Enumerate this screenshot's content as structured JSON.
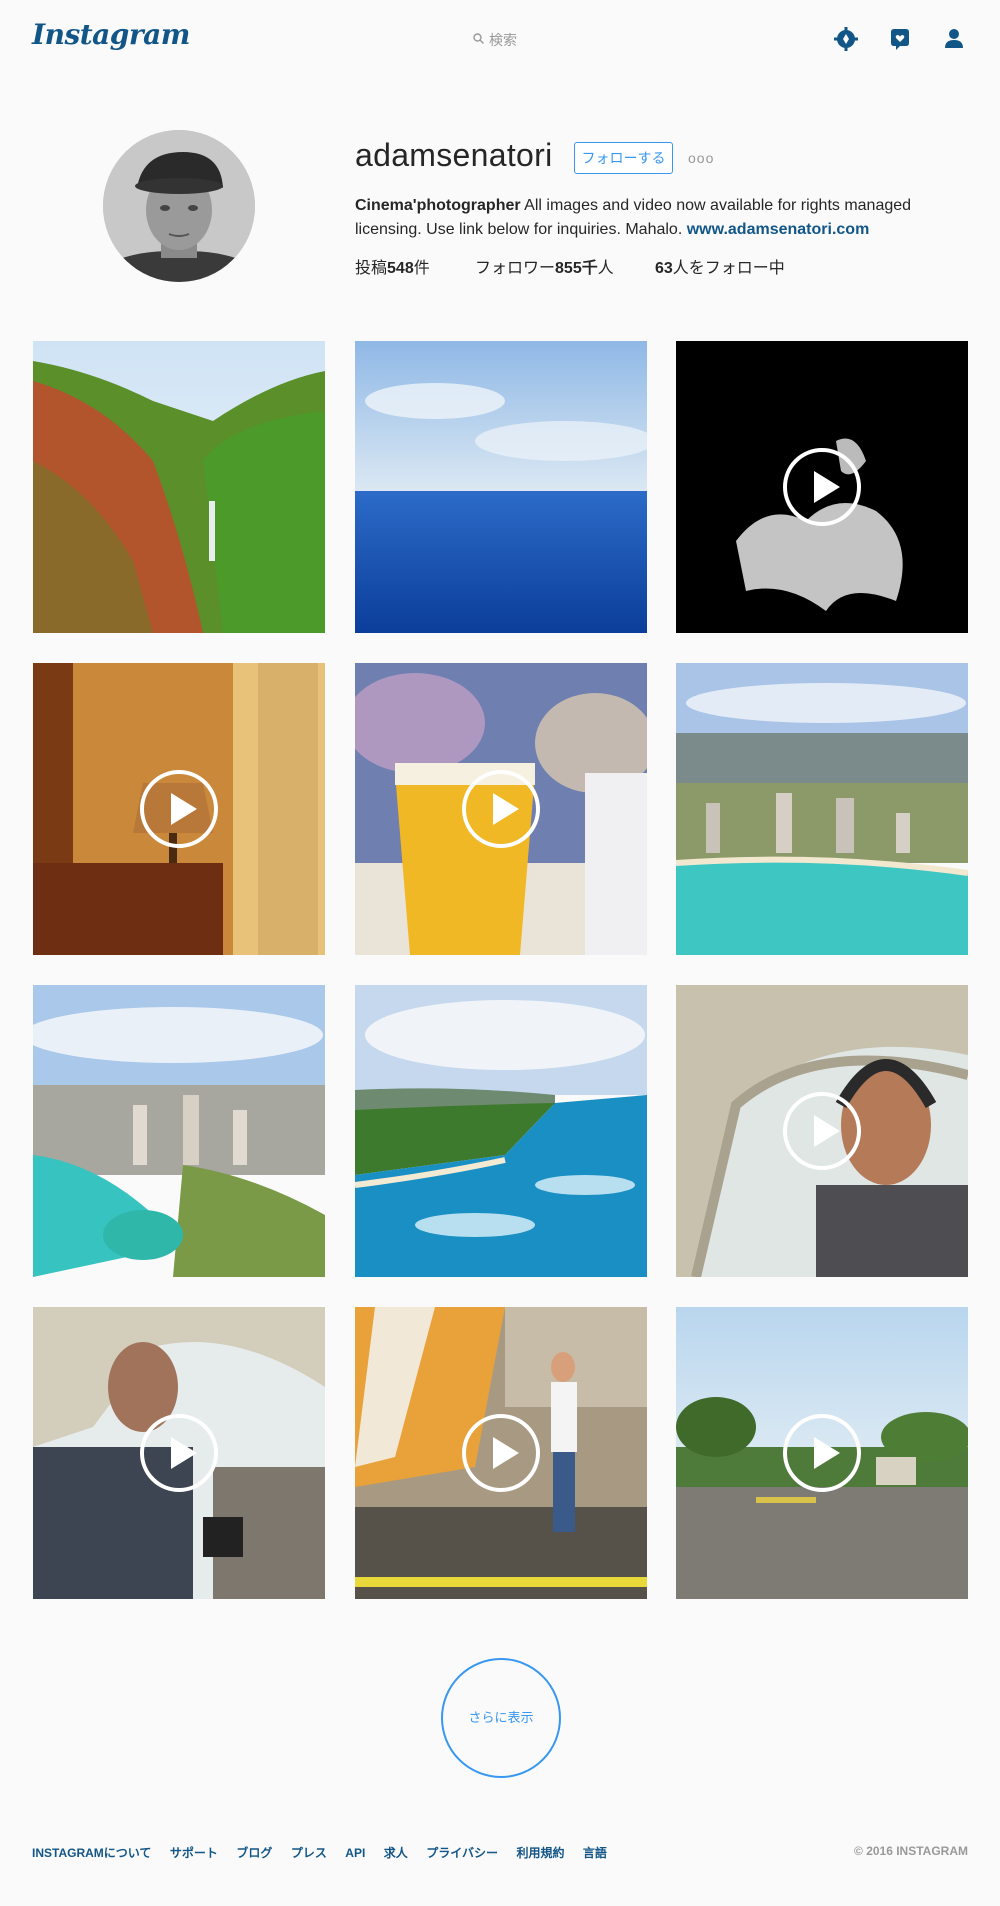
{
  "header": {
    "logo": "Instagram",
    "search_placeholder": "検索",
    "icons": [
      "compass-icon",
      "heart-icon",
      "user-icon"
    ]
  },
  "profile": {
    "username": "adamsenatori",
    "follow_label": "フォローする",
    "more_label": "ooo",
    "bio_name": "Cinema'photographer",
    "bio_text": " All images and video now available for rights managed licensing. Use link below for inquiries. Mahalo. ",
    "bio_link": "www.adamsenatori.com",
    "stats": {
      "posts_prefix": "投稿",
      "posts_count": "548",
      "posts_suffix": "件",
      "followers_prefix": "フォロワー",
      "followers_count": "855千",
      "followers_suffix": "人",
      "following_count": "63",
      "following_suffix": "人をフォロー中"
    }
  },
  "posts": [
    {
      "subject": "green valley waterfall",
      "video": false
    },
    {
      "subject": "ocean horizon",
      "video": false
    },
    {
      "subject": "dark abstract",
      "video": true
    },
    {
      "subject": "bedside lamp",
      "video": true
    },
    {
      "subject": "beer glass",
      "video": true
    },
    {
      "subject": "aerial city coastline",
      "video": false
    },
    {
      "subject": "aerial city harbor",
      "video": false
    },
    {
      "subject": "aerial north shore",
      "video": false
    },
    {
      "subject": "helicopter pilot",
      "video": true
    },
    {
      "subject": "pilot cockpit",
      "video": true
    },
    {
      "subject": "helicopter ground",
      "video": true
    },
    {
      "subject": "palm trees tarmac",
      "video": true
    }
  ],
  "load_more_label": "さらに表示",
  "footer": {
    "links": [
      "INSTAGRAMについて",
      "サポート",
      "ブログ",
      "プレス",
      "API",
      "求人",
      "プライバシー",
      "利用規約",
      "言語"
    ],
    "copyright": "© 2016 INSTAGRAM"
  },
  "colors": {
    "accent": "#3897f0",
    "link": "#125688",
    "background": "#fafafa"
  }
}
